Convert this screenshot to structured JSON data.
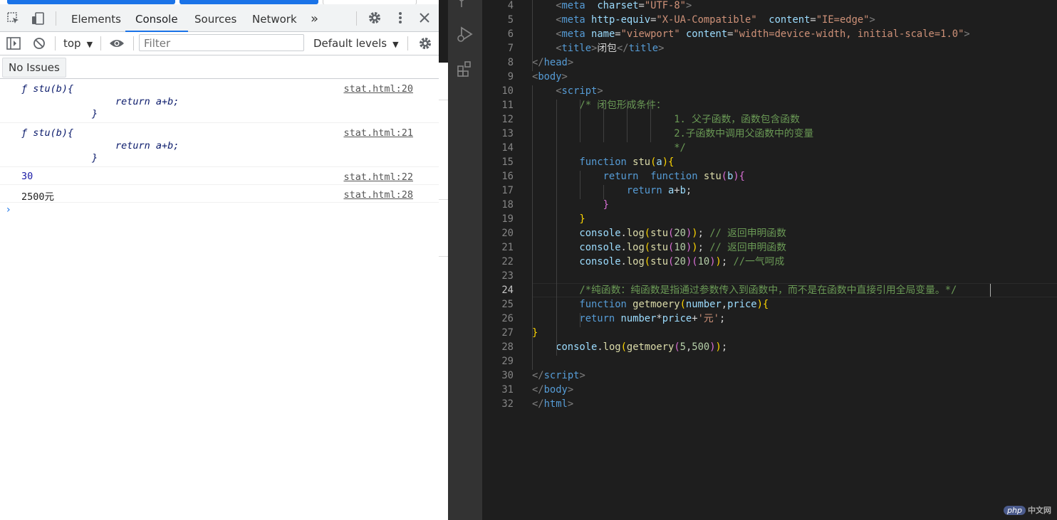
{
  "devtools": {
    "tabs": [
      "Elements",
      "Console",
      "Sources",
      "Network"
    ],
    "active_tab": "Console",
    "more_tabs": "»",
    "toolbar": {
      "context": "top",
      "filter_placeholder": "Filter",
      "levels": "Default levels"
    },
    "issues_button": "No Issues",
    "messages": [
      {
        "lines": [
          "ƒ stu(b){",
          "return a+b;",
          "}"
        ],
        "source": "stat.html:20"
      },
      {
        "lines": [
          "ƒ stu(b){",
          "return a+b;",
          "}"
        ],
        "source": "stat.html:21"
      },
      {
        "text": "30",
        "source": "stat.html:22"
      },
      {
        "text": "2500元",
        "source": "stat.html:28"
      }
    ],
    "prompt": "›"
  },
  "editor": {
    "current_line": 24,
    "lines": [
      {
        "n": "4",
        "segs": [
          [
            "tg",
            "<"
          ],
          [
            "tn",
            "meta"
          ],
          [
            "",
            "  "
          ],
          [
            "at",
            "charset"
          ],
          [
            "",
            "="
          ],
          [
            "st",
            "\"UTF-8\""
          ],
          [
            "tg",
            ">"
          ]
        ]
      },
      {
        "n": "5",
        "segs": [
          [
            "tg",
            "<"
          ],
          [
            "tn",
            "meta"
          ],
          [
            "",
            ""
          ],
          [
            "at",
            " http-equiv"
          ],
          [
            "",
            "="
          ],
          [
            "st",
            "\"X-UA-Compatible\""
          ],
          [
            "",
            "  "
          ],
          [
            "at",
            "content"
          ],
          [
            "",
            "="
          ],
          [
            "st",
            "\"IE=edge\""
          ],
          [
            "tg",
            ">"
          ]
        ]
      },
      {
        "n": "6",
        "segs": [
          [
            "tg",
            "<"
          ],
          [
            "tn",
            "meta"
          ],
          [
            "",
            ""
          ],
          [
            "at",
            " name"
          ],
          [
            "",
            "="
          ],
          [
            "st",
            "\"viewport\""
          ],
          [
            "",
            ""
          ],
          [
            "at",
            " content"
          ],
          [
            "",
            "="
          ],
          [
            "st",
            "\"width=device-width, initial-scale=1.0\""
          ],
          [
            "tg",
            ">"
          ]
        ]
      },
      {
        "n": "7",
        "segs": [
          [
            "tg",
            "<"
          ],
          [
            "tn",
            "title"
          ],
          [
            "tg",
            ">"
          ],
          [
            "",
            "闭包"
          ],
          [
            "tg",
            "</"
          ],
          [
            "tn",
            "title"
          ],
          [
            "tg",
            ">"
          ]
        ]
      },
      {
        "n": "8",
        "segs": [
          [
            "tg",
            "</"
          ],
          [
            "tn",
            "head"
          ],
          [
            "tg",
            ">"
          ]
        ]
      },
      {
        "n": "9",
        "segs": [
          [
            "tg",
            "<"
          ],
          [
            "tn",
            "body"
          ],
          [
            "tg",
            ">"
          ]
        ]
      },
      {
        "n": "10",
        "segs": [
          [
            "tg",
            "<"
          ],
          [
            "tn",
            "script"
          ],
          [
            "tg",
            ">"
          ]
        ]
      },
      {
        "n": "11",
        "segs": [
          [
            "cm",
            "/* 闭包形成条件："
          ]
        ]
      },
      {
        "n": "12",
        "segs": [
          [
            "cm",
            "1. 父子函数，函数包含函数"
          ]
        ]
      },
      {
        "n": "13",
        "segs": [
          [
            "cm",
            "2.子函数中调用父函数中的变量"
          ]
        ]
      },
      {
        "n": "14",
        "segs": [
          [
            "cm",
            "*/"
          ]
        ]
      },
      {
        "n": "15",
        "segs": [
          [
            "kw",
            "function"
          ],
          [
            "",
            " "
          ],
          [
            "fnm",
            "stu"
          ],
          [
            "b1",
            "("
          ],
          [
            "vr",
            "a"
          ],
          [
            "b1",
            "){"
          ]
        ]
      },
      {
        "n": "16",
        "segs": [
          [
            "kw",
            "return"
          ],
          [
            "",
            "  "
          ],
          [
            "kw",
            "function"
          ],
          [
            "",
            " "
          ],
          [
            "fnm",
            "stu"
          ],
          [
            "b2",
            "("
          ],
          [
            "vr",
            "b"
          ],
          [
            "b2",
            "){"
          ]
        ]
      },
      {
        "n": "17",
        "segs": [
          [
            "kw",
            "return"
          ],
          [
            "",
            " "
          ],
          [
            "vr",
            "a"
          ],
          [
            "",
            "+"
          ],
          [
            "vr",
            "b"
          ],
          [
            "",
            ";"
          ]
        ]
      },
      {
        "n": "18",
        "segs": [
          [
            "b2",
            "}"
          ]
        ]
      },
      {
        "n": "19",
        "segs": [
          [
            "b1",
            "}"
          ]
        ]
      },
      {
        "n": "20",
        "segs": [
          [
            "vr",
            "console"
          ],
          [
            "",
            "."
          ],
          [
            "fnm",
            "log"
          ],
          [
            "b1",
            "("
          ],
          [
            "fnm",
            "stu"
          ],
          [
            "b2",
            "("
          ],
          [
            "nm",
            "20"
          ],
          [
            "b2",
            ")"
          ],
          [
            "b1",
            ")"
          ],
          [
            "",
            "; "
          ],
          [
            "cm",
            "// 返回申明函数"
          ]
        ]
      },
      {
        "n": "21",
        "segs": [
          [
            "vr",
            "console"
          ],
          [
            "",
            "."
          ],
          [
            "fnm",
            "log"
          ],
          [
            "b1",
            "("
          ],
          [
            "fnm",
            "stu"
          ],
          [
            "b2",
            "("
          ],
          [
            "nm",
            "10"
          ],
          [
            "b2",
            ")"
          ],
          [
            "b1",
            ")"
          ],
          [
            "",
            "; "
          ],
          [
            "cm",
            "// 返回申明函数"
          ]
        ]
      },
      {
        "n": "22",
        "segs": [
          [
            "vr",
            "console"
          ],
          [
            "",
            "."
          ],
          [
            "fnm",
            "log"
          ],
          [
            "b1",
            "("
          ],
          [
            "fnm",
            "stu"
          ],
          [
            "b2",
            "("
          ],
          [
            "nm",
            "20"
          ],
          [
            "b2",
            ")("
          ],
          [
            "nm",
            "10"
          ],
          [
            "b2",
            ")"
          ],
          [
            "b1",
            ")"
          ],
          [
            "",
            "; "
          ],
          [
            "cm",
            "//一气呵成"
          ]
        ]
      },
      {
        "n": "23",
        "segs": []
      },
      {
        "n": "24",
        "segs": [
          [
            "cm",
            "/*纯函数：纯函数是指通过参数传入到函数中，而不是在函数中直接引用全局变量。*/"
          ]
        ]
      },
      {
        "n": "25",
        "segs": [
          [
            "kw",
            "function"
          ],
          [
            "",
            " "
          ],
          [
            "fnm",
            "getmoery"
          ],
          [
            "b1",
            "("
          ],
          [
            "vr",
            "number"
          ],
          [
            "",
            ","
          ],
          [
            "vr",
            "price"
          ],
          [
            "b1",
            "){"
          ]
        ]
      },
      {
        "n": "26",
        "segs": [
          [
            "kw",
            "return"
          ],
          [
            "",
            " "
          ],
          [
            "vr",
            "number"
          ],
          [
            "",
            "*"
          ],
          [
            "vr",
            "price"
          ],
          [
            "",
            "+"
          ],
          [
            "st",
            "'元'"
          ],
          [
            "",
            ";"
          ]
        ]
      },
      {
        "n": "27",
        "segs": [
          [
            "b1",
            "}"
          ]
        ]
      },
      {
        "n": "28",
        "segs": [
          [
            "vr",
            "console"
          ],
          [
            "",
            "."
          ],
          [
            "fnm",
            "log"
          ],
          [
            "b1",
            "("
          ],
          [
            "fnm",
            "getmoery"
          ],
          [
            "b2",
            "("
          ],
          [
            "nm",
            "5"
          ],
          [
            "",
            ","
          ],
          [
            "nm",
            "500"
          ],
          [
            "b2",
            ")"
          ],
          [
            "b1",
            ")"
          ],
          [
            "",
            ";"
          ]
        ]
      },
      {
        "n": "29",
        "segs": []
      },
      {
        "n": "30",
        "segs": [
          [
            "tg",
            "</"
          ],
          [
            "tn",
            "script"
          ],
          [
            "tg",
            ">"
          ]
        ]
      },
      {
        "n": "31",
        "segs": [
          [
            "tg",
            "</"
          ],
          [
            "tn",
            "body"
          ],
          [
            "tg",
            ">"
          ]
        ]
      },
      {
        "n": "32",
        "segs": [
          [
            "tg",
            "</"
          ],
          [
            "tn",
            "html"
          ],
          [
            "tg",
            ">"
          ]
        ]
      }
    ],
    "watermark": {
      "badge": "php",
      "text": "中文网"
    }
  },
  "colors": {
    "accent": "#1a73e8",
    "editor_bg": "#1e1e1e",
    "activity_bg": "#333333"
  }
}
